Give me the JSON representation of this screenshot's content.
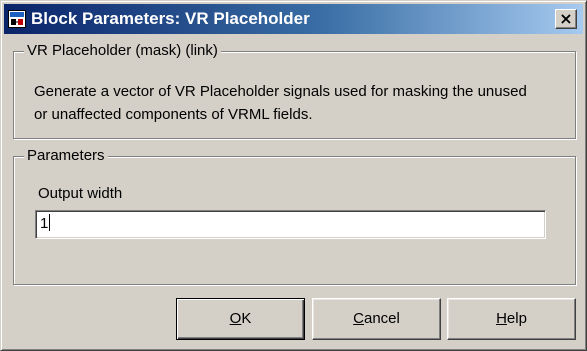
{
  "window": {
    "title": "Block Parameters: VR Placeholder",
    "close_glyph": "×",
    "icon": "simulink-block-icon"
  },
  "mask": {
    "legend": "VR Placeholder (mask) (link)",
    "description": "Generate a vector of VR Placeholder signals used for masking the unused or unaffected components of VRML fields."
  },
  "parameters": {
    "legend": "Parameters",
    "output_width": {
      "label": "Output width",
      "value": "1"
    }
  },
  "buttons": {
    "ok": {
      "mnemonic": "O",
      "rest": "K"
    },
    "cancel": {
      "mnemonic": "C",
      "rest": "ancel"
    },
    "help": {
      "mnemonic": "H",
      "rest": "elp"
    }
  }
}
